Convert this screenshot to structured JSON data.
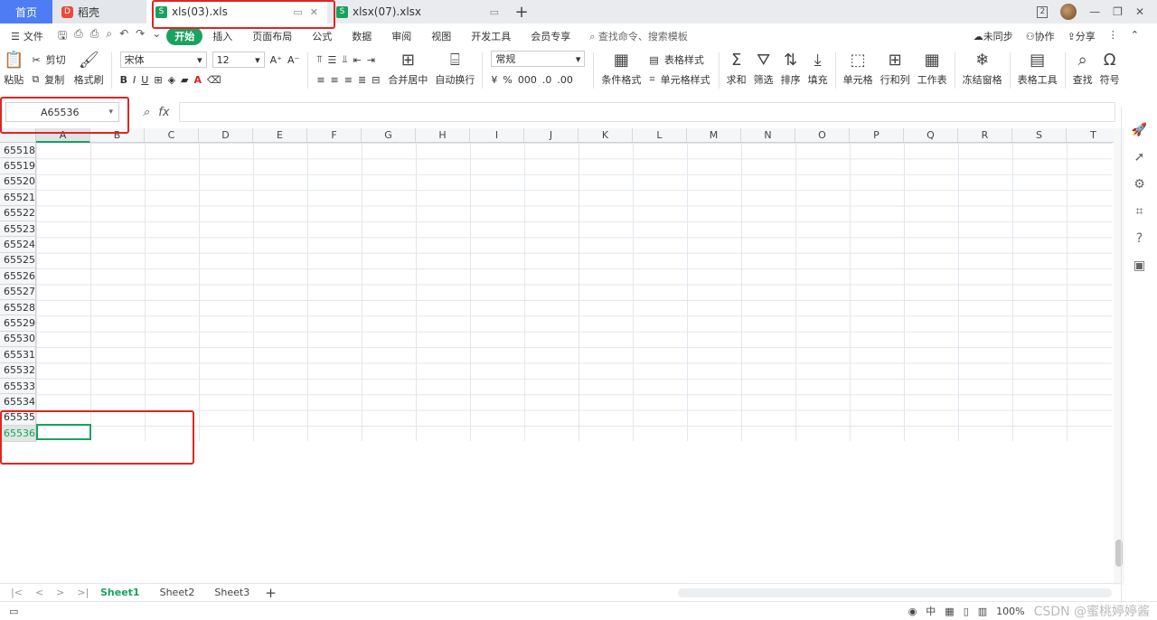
{
  "titlebar": {
    "home_label": "首页",
    "daoke_label": "稻壳",
    "tab1_label": "xls(03).xls",
    "tab2_label": "xlsx(07).xlsx",
    "new_tab": "+",
    "window_count": "2"
  },
  "menubar": {
    "file_label": "文件",
    "tabs": [
      "开始",
      "插入",
      "页面布局",
      "公式",
      "数据",
      "审阅",
      "视图",
      "开发工具",
      "会员专享"
    ],
    "search_label": "查找命令、搜索模板",
    "sync_label": "未同步",
    "collab_label": "协作",
    "share_label": "分享"
  },
  "ribbon": {
    "paste": "粘贴",
    "cut": "剪切",
    "copy": "复制",
    "format_painter": "格式刷",
    "font_name": "宋体",
    "font_size": "12",
    "merge_center": "合并居中",
    "wrap_text": "自动换行",
    "number_format": "常规",
    "cond_format": "条件格式",
    "table_style": "表格样式",
    "cell_style": "单元格样式",
    "sum": "求和",
    "filter": "筛选",
    "sort": "排序",
    "fill": "填充",
    "cell": "单元格",
    "rowcol": "行和列",
    "worksheet": "工作表",
    "freeze": "冻结窗格",
    "table_tools": "表格工具",
    "find": "查找",
    "symbol": "符号"
  },
  "formula": {
    "name_box": "A65536",
    "fx": "fx"
  },
  "grid": {
    "columns": [
      "A",
      "B",
      "C",
      "D",
      "E",
      "F",
      "G",
      "H",
      "I",
      "J",
      "K",
      "L",
      "M",
      "N",
      "O",
      "P",
      "Q",
      "R",
      "S",
      "T"
    ],
    "rows": [
      "65518",
      "65519",
      "65520",
      "65521",
      "65522",
      "65523",
      "65524",
      "65525",
      "65526",
      "65527",
      "65528",
      "65529",
      "65530",
      "65531",
      "65532",
      "65533",
      "65534",
      "65535",
      "65536"
    ],
    "selected_column": "A",
    "selected_row": "65536"
  },
  "sheets": {
    "names": [
      "Sheet1",
      "Sheet2",
      "Sheet3"
    ],
    "active": "Sheet1",
    "add": "+"
  },
  "status": {
    "zoom": "100%",
    "lang": "中",
    "watermark": "CSDN @蜜桃婷婷酱"
  },
  "colors": {
    "accent": "#1aa35f",
    "home_tab": "#4d7cf5",
    "annotation": "#e02424"
  }
}
